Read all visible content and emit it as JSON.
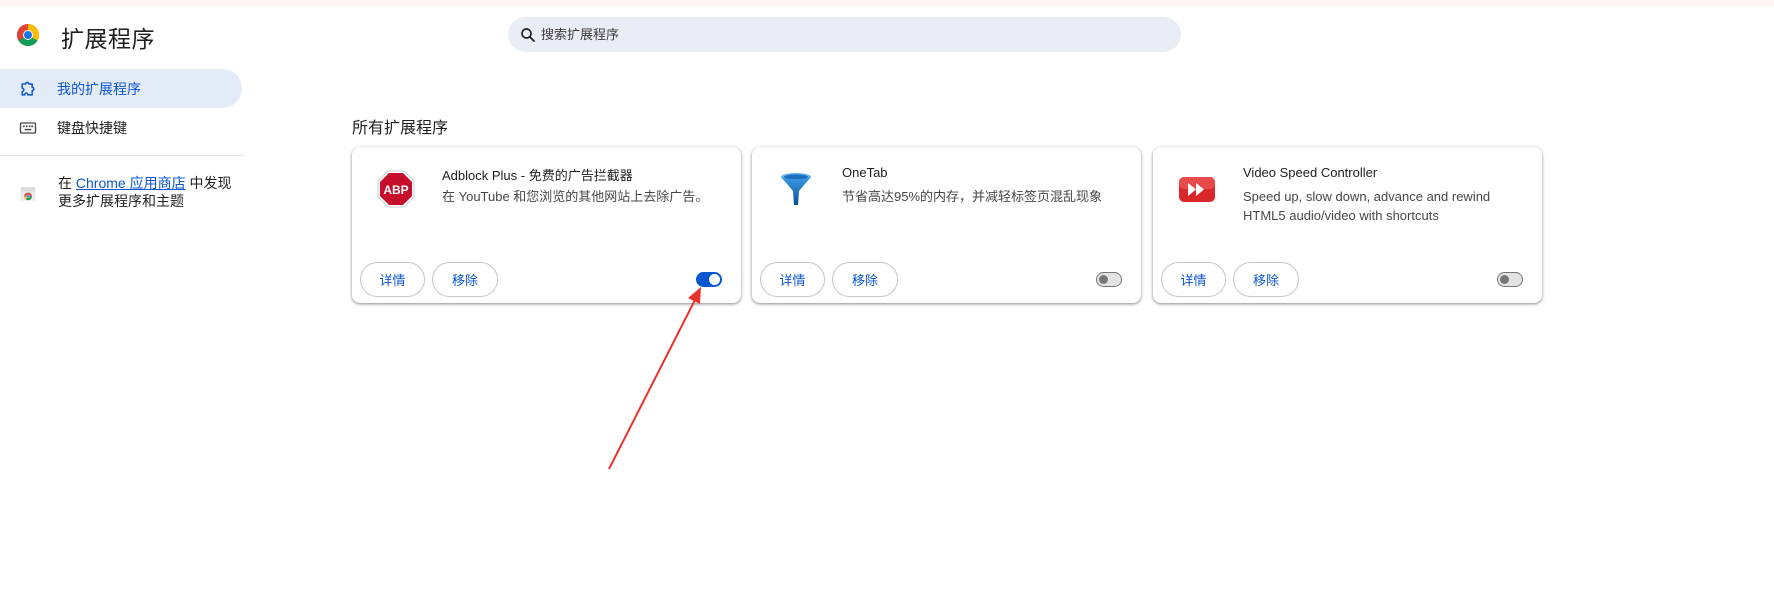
{
  "header": {
    "title": "扩展程序",
    "search_placeholder": "搜索扩展程序"
  },
  "sidebar": {
    "items": [
      {
        "label": "我的扩展程序",
        "icon": "extension-puzzle-icon",
        "active": true
      },
      {
        "label": "键盘快捷键",
        "icon": "keyboard-icon",
        "active": false
      }
    ],
    "store_prefix": "在",
    "store_link": "Chrome 应用商店",
    "store_suffix": "中发现更多扩展程序和主题"
  },
  "main": {
    "section_title": "所有扩展程序",
    "extensions": [
      {
        "name": "Adblock Plus - 免费的广告拦截器",
        "description": "在 YouTube 和您浏览的其他网站上去除广告。",
        "icon": "abp-octagon-icon",
        "enabled": true,
        "details_label": "详情",
        "remove_label": "移除"
      },
      {
        "name": "OneTab",
        "description": "节省高达95%的内存，并减轻标签页混乱现象",
        "icon": "onetab-funnel-icon",
        "enabled": false,
        "details_label": "详情",
        "remove_label": "移除"
      },
      {
        "name": "Video Speed Controller",
        "description": "Speed up, slow down, advance and rewind HTML5 audio/video with shortcuts",
        "icon": "video-speed-controller-icon",
        "enabled": false,
        "details_label": "详情",
        "remove_label": "移除"
      }
    ]
  },
  "colors": {
    "accent": "#0b57d0",
    "nav_active_bg": "#e3ebf8",
    "search_bg": "#e9edf6",
    "annotation_arrow": "#e8322b"
  }
}
